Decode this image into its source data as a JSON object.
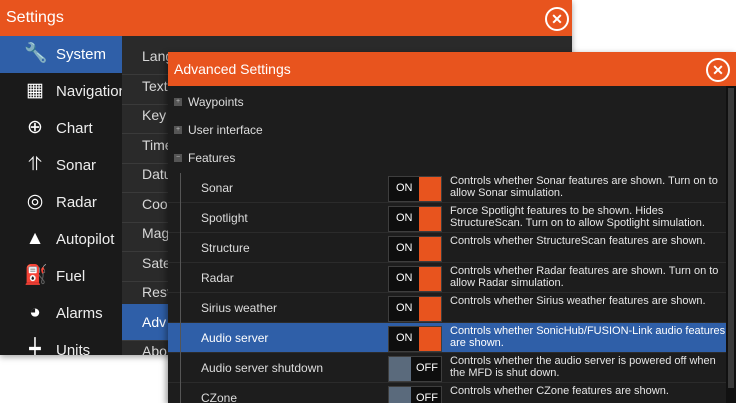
{
  "settings": {
    "title": "Settings",
    "sidebar": [
      {
        "label": "System",
        "icon": "wrench-icon",
        "glyph": "🔧"
      },
      {
        "label": "Navigation",
        "icon": "navigation-icon",
        "glyph": "▦"
      },
      {
        "label": "Chart",
        "icon": "globe-icon",
        "glyph": "⊕"
      },
      {
        "label": "Sonar",
        "icon": "sonar-icon",
        "glyph": "⥣"
      },
      {
        "label": "Radar",
        "icon": "radar-icon",
        "glyph": "◎"
      },
      {
        "label": "Autopilot",
        "icon": "autopilot-icon",
        "glyph": "▲"
      },
      {
        "label": "Fuel",
        "icon": "fuel-icon",
        "glyph": "⛽"
      },
      {
        "label": "Alarms",
        "icon": "alarm-icon",
        "glyph": "◕"
      },
      {
        "label": "Units",
        "icon": "units-icon",
        "glyph": "┿"
      }
    ],
    "submenu": [
      "Language",
      "Text",
      "Key",
      "Time",
      "Datum",
      "Coo",
      "Mag",
      "Sate",
      "Rest",
      "Adv",
      "Abo"
    ]
  },
  "advanced": {
    "title": "Advanced Settings",
    "tree": [
      {
        "label": "Waypoints",
        "expander": "+"
      },
      {
        "label": "User interface",
        "expander": "+"
      },
      {
        "label": "Features",
        "expander": "−"
      }
    ],
    "features": [
      {
        "name": "Sonar",
        "state": "ON",
        "desc": "Controls whether Sonar features are shown. Turn on to allow Sonar simulation."
      },
      {
        "name": "Spotlight",
        "state": "ON",
        "desc": "Force Spotlight features to be shown. Hides StructureScan. Turn on to allow Spotlight simulation."
      },
      {
        "name": "Structure",
        "state": "ON",
        "desc": "Controls whether StructureScan features are shown."
      },
      {
        "name": "Radar",
        "state": "ON",
        "desc": "Controls whether Radar features are shown. Turn on to allow Radar simulation."
      },
      {
        "name": "Sirius weather",
        "state": "ON",
        "desc": "Controls whether Sirius weather features are shown."
      },
      {
        "name": "Audio server",
        "state": "ON",
        "desc": "Controls whether SonicHub/FUSION-Link audio features are shown."
      },
      {
        "name": "Audio server shutdown",
        "state": "OFF",
        "desc": "Controls whether the audio server is powered off when the MFD is shut down."
      },
      {
        "name": "CZone",
        "state": "OFF",
        "desc": "Controls whether CZone features are shown."
      }
    ]
  },
  "colors": {
    "accent": "#e8541e",
    "selection": "#2f5fa8",
    "toggle_off": "#5a6a7c"
  }
}
